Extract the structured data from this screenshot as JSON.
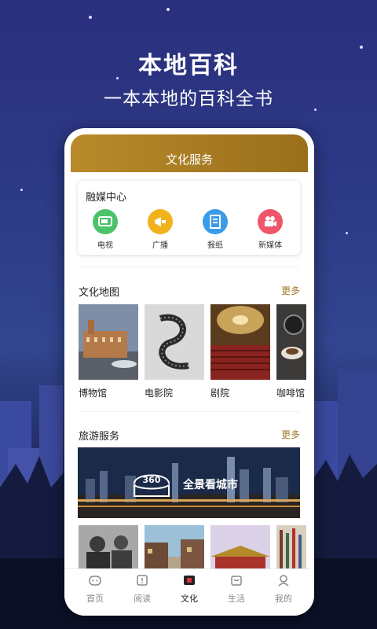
{
  "hero": {
    "title": "本地百科",
    "subtitle": "一本本地的百科全书"
  },
  "header": {
    "title": "文化服务"
  },
  "media_center": {
    "title": "融媒中心",
    "items": [
      {
        "label": "电视",
        "icon": "tv-icon",
        "color": "#4cc36a"
      },
      {
        "label": "广播",
        "icon": "megaphone-icon",
        "color": "#f2b21c"
      },
      {
        "label": "报纸",
        "icon": "newspaper-icon",
        "color": "#3a9be8"
      },
      {
        "label": "新媒体",
        "icon": "video-camera-icon",
        "color": "#f0566b"
      }
    ]
  },
  "culture_map": {
    "title": "文化地图",
    "more": "更多",
    "items": [
      {
        "label": "博物馆"
      },
      {
        "label": "电影院"
      },
      {
        "label": "剧院"
      },
      {
        "label": "咖啡馆"
      }
    ]
  },
  "travel": {
    "title": "旅游服务",
    "more": "更多",
    "banner_badge": "360",
    "banner_text": "全景看城市"
  },
  "tabs": [
    {
      "label": "首页",
      "icon": "home-icon",
      "active": false
    },
    {
      "label": "阅读",
      "icon": "book-icon",
      "active": false
    },
    {
      "label": "文化",
      "icon": "culture-icon",
      "active": true
    },
    {
      "label": "生活",
      "icon": "shopping-bag-icon",
      "active": false
    },
    {
      "label": "我的",
      "icon": "user-icon",
      "active": false
    }
  ],
  "colors": {
    "accent": "#a07a2a",
    "header_gold": "#b88a2a",
    "active_tab": "#e0303a"
  }
}
